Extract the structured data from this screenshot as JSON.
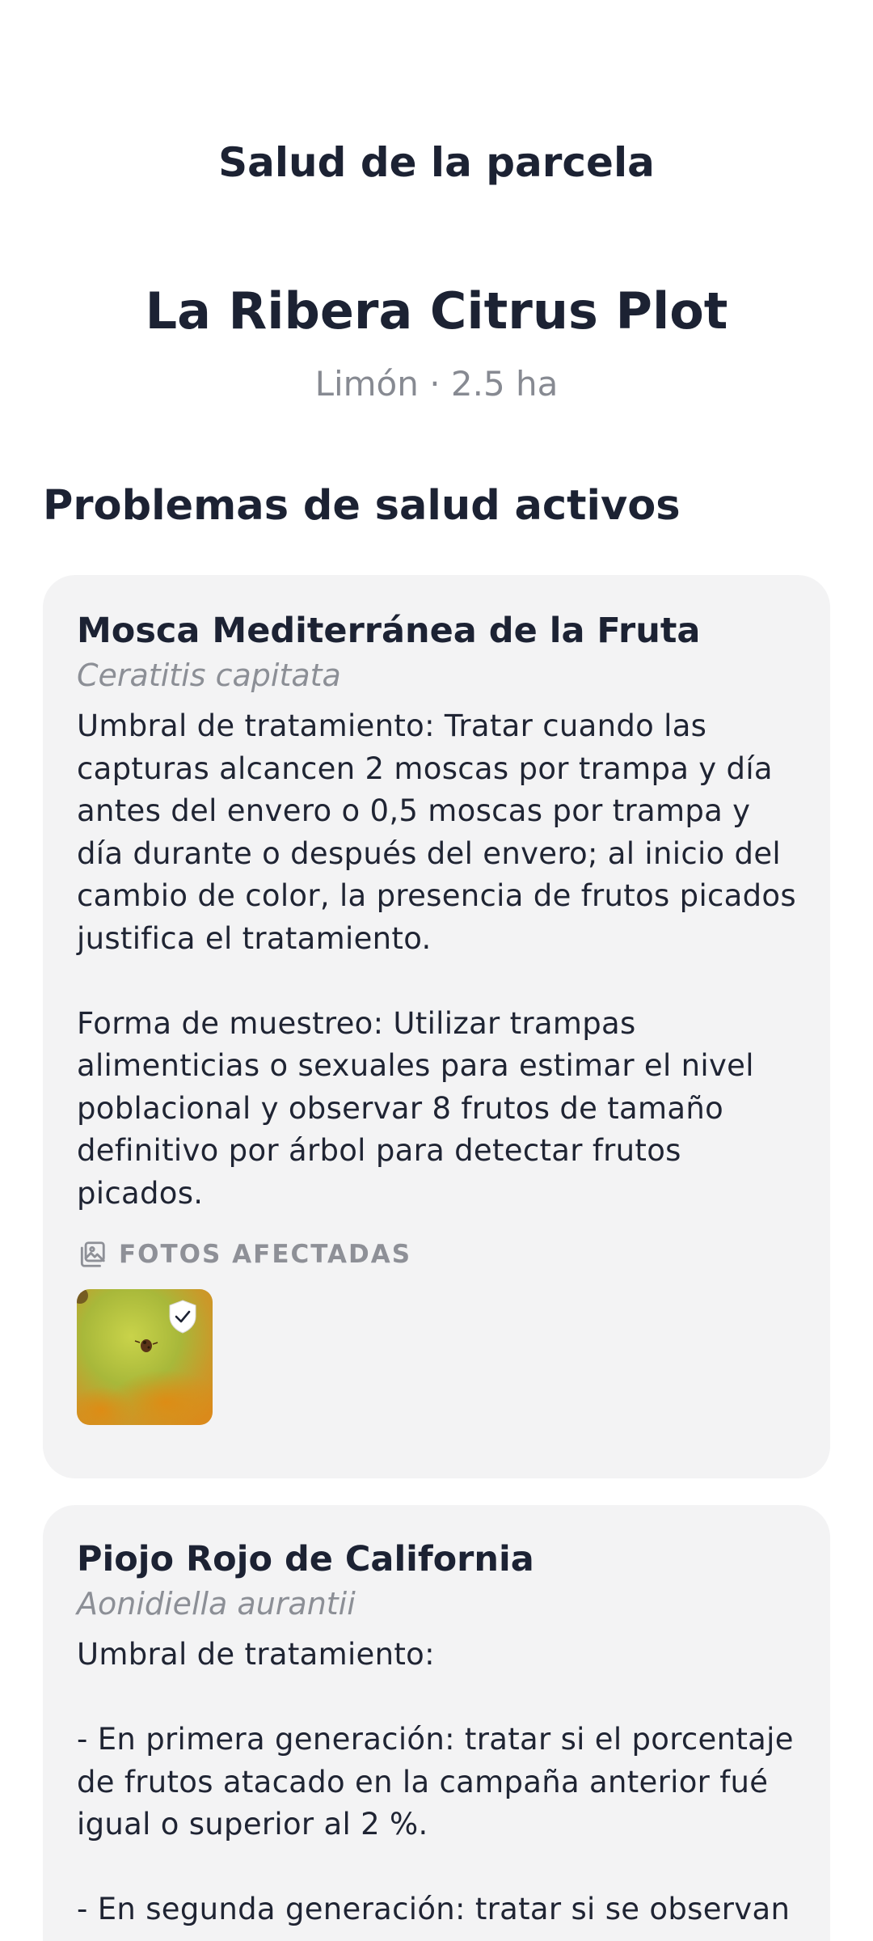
{
  "header": {
    "title": "Salud de la parcela"
  },
  "plot": {
    "name": "La Ribera Citrus Plot",
    "meta": "Limón · 2.5 ha"
  },
  "section_title": "Problemas de salud activos",
  "issues": [
    {
      "title": "Mosca Mediterránea de la Fruta",
      "scientific_name": "Ceratitis capitata",
      "body": "Umbral de tratamiento: Tratar cuando las capturas alcancen 2 moscas por trampa y día antes del envero o 0,5 moscas por trampa y día durante o después del envero; al inicio del cambio de color, la presencia de frutos picados justifica el tratamiento.\n\nForma de muestreo: Utilizar trampas alimenticias o sexuales para estimar el nivel poblacional y observar 8 frutos de tamaño definitivo por árbol para detectar frutos picados.",
      "photos_label": "FOTOS AFECTADAS",
      "photos": [
        {
          "description": "leaf-photo",
          "verified": true
        }
      ]
    },
    {
      "title": "Piojo Rojo de California",
      "scientific_name": "Aonidiella aurantii",
      "body": "Umbral de tratamiento:\n\n- En primera generación: tratar si el porcentaje de frutos atacado en la campaña anterior fué igual o superior al 2 %.\n\n- En segunda generación: tratar si se observan"
    }
  ],
  "colors": {
    "card_bg": "#f3f3f4",
    "text_primary": "#1c2233",
    "text_muted": "#878a92"
  }
}
